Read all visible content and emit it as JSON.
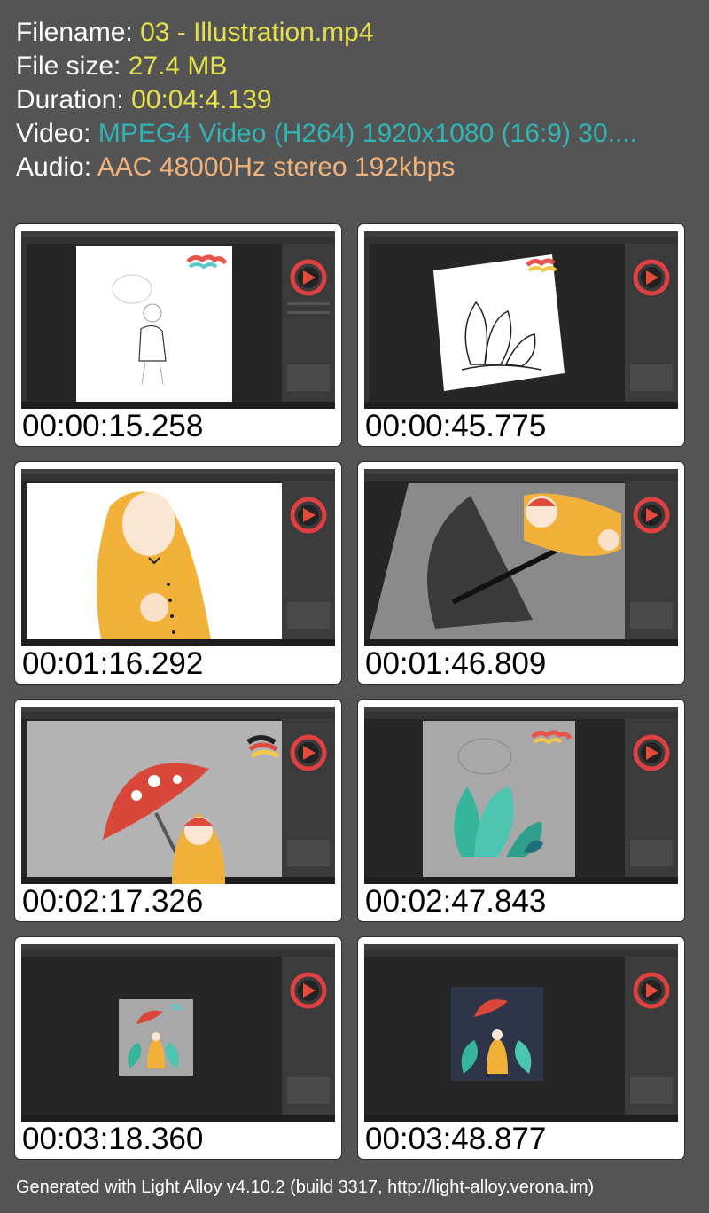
{
  "meta": [
    {
      "label": "Filename:",
      "value": "03 - Illustration.mp4",
      "color": "#e4e04c"
    },
    {
      "label": "File size:",
      "value": "27.4 MB",
      "color": "#e4e04c"
    },
    {
      "label": "Duration:",
      "value": "00:04:4.139",
      "color": "#e4e04c"
    },
    {
      "label": "Video:",
      "value": "MPEG4 Video (H264) 1920x1080 (16:9) 30....",
      "color": "#2fb5b5"
    },
    {
      "label": "Audio:",
      "value": "AAC 48000Hz stereo 192kbps",
      "color": "#f2b27c"
    }
  ],
  "thumbs": [
    {
      "time": "00:00:15.258",
      "scene": "sketch-canvas-white"
    },
    {
      "time": "00:00:45.775",
      "scene": "plant-lineart-rotated"
    },
    {
      "time": "00:01:16.292",
      "scene": "yellow-raincoat-closeup"
    },
    {
      "time": "00:01:46.809",
      "scene": "umbrella-grey-painting"
    },
    {
      "time": "00:02:17.326",
      "scene": "red-mushroom-umbrella"
    },
    {
      "time": "00:02:47.843",
      "scene": "teal-leaves-layer"
    },
    {
      "time": "00:03:18.360",
      "scene": "full-illustration-small"
    },
    {
      "time": "00:03:48.877",
      "scene": "full-illustration-dark"
    }
  ],
  "footer": "Generated with Light Alloy v4.10.2 (build 3317, http://light-alloy.verona.im)",
  "colors": {
    "background": "#545454",
    "label": "#ffffff",
    "accent_yellow": "#e4e04c",
    "accent_teal": "#2fb5b5",
    "accent_orange": "#f2b27c"
  }
}
